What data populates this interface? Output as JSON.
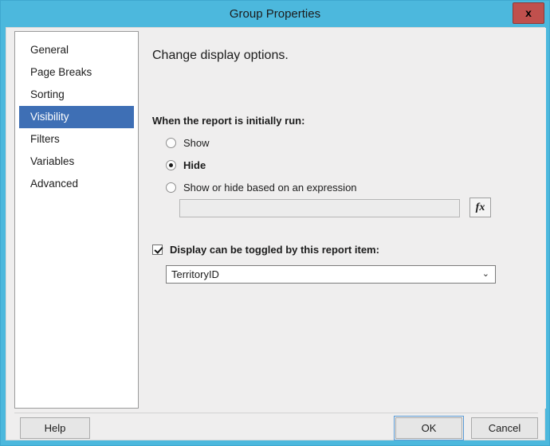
{
  "window": {
    "title": "Group Properties",
    "close_label": "x",
    "accent_color": "#4cb8dd",
    "selection_color": "#3e6fb5",
    "default_button_outline": "#5b9bd5"
  },
  "sidebar": {
    "items": [
      {
        "label": "General",
        "selected": false
      },
      {
        "label": "Page Breaks",
        "selected": false
      },
      {
        "label": "Sorting",
        "selected": false
      },
      {
        "label": "Visibility",
        "selected": true
      },
      {
        "label": "Filters",
        "selected": false
      },
      {
        "label": "Variables",
        "selected": false
      },
      {
        "label": "Advanced",
        "selected": false
      }
    ]
  },
  "main": {
    "heading": "Change display options.",
    "section_label": "When the report is initially run:",
    "radios": [
      {
        "label": "Show",
        "checked": false
      },
      {
        "label": "Hide",
        "checked": true
      },
      {
        "label": "Show or hide based on an expression",
        "checked": false
      }
    ],
    "expression": {
      "value": "",
      "placeholder": "",
      "enabled": false
    },
    "fx_button": {
      "label": "fx"
    },
    "toggle_checkbox": {
      "label": "Display can be toggled by this report item:",
      "checked": true
    },
    "report_item_dropdown": {
      "value": "TerritoryID",
      "arrow": "⌄"
    }
  },
  "footer": {
    "help_label": "Help",
    "ok_label": "OK",
    "cancel_label": "Cancel"
  }
}
